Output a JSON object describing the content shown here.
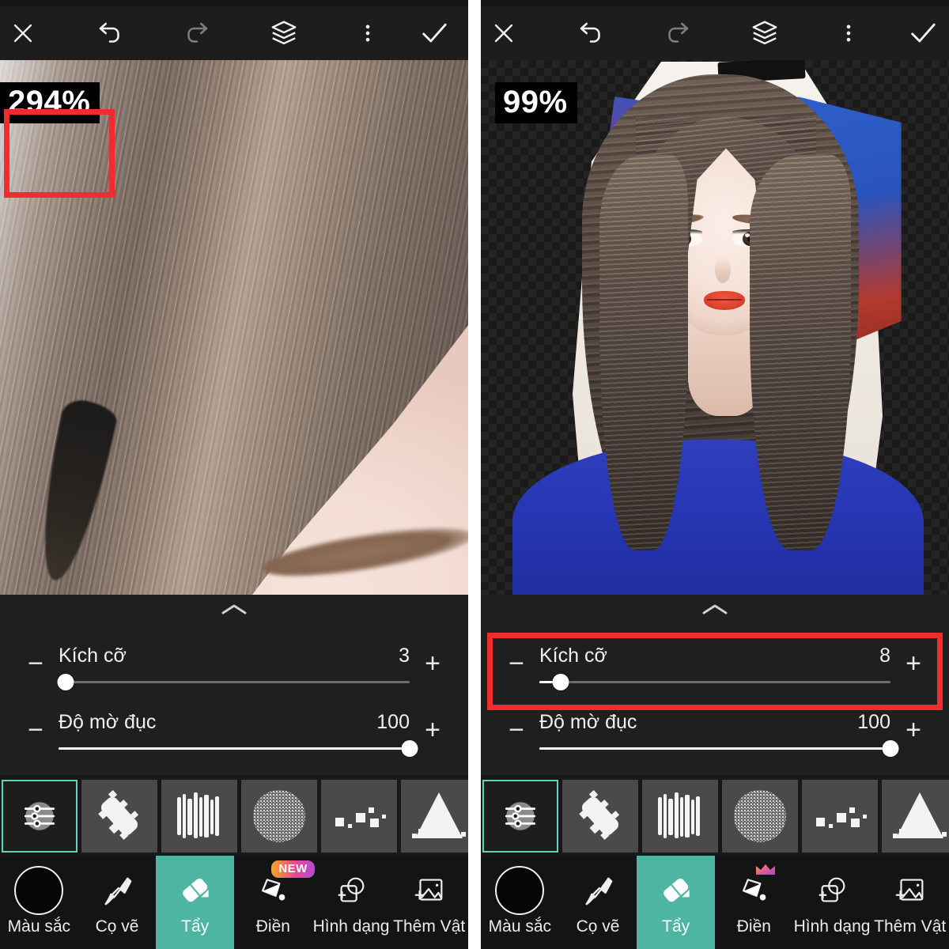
{
  "app": {
    "accent_teal": "#4fb5a3",
    "annotation_red": "#ef2d2d",
    "panel_bg": "#141414",
    "controls_bg": "#1f1f1f"
  },
  "panels": [
    {
      "id": "before",
      "topbar": {
        "close_label": "×",
        "undo_label": "undo",
        "redo_label": "redo",
        "layers_label": "layers",
        "more_label": "more",
        "confirm_label": "✓"
      },
      "canvas": {
        "zoom_level": "294%"
      },
      "sliders": [
        {
          "name": "size",
          "label": "Kích cỡ",
          "value": "3",
          "percent": 2,
          "minus": "−",
          "plus": "+",
          "fill": false
        },
        {
          "name": "opacity",
          "label": "Độ mờ đục",
          "value": "100",
          "percent": 100,
          "minus": "−",
          "plus": "+",
          "fill": true
        }
      ],
      "brushes": [
        {
          "name": "brush-settings",
          "selected": true
        },
        {
          "name": "brush-chalk",
          "selected": false
        },
        {
          "name": "brush-bristle",
          "selected": false
        },
        {
          "name": "brush-noise",
          "selected": false
        },
        {
          "name": "brush-squares",
          "selected": false
        },
        {
          "name": "brush-spray",
          "selected": false
        }
      ],
      "tools": [
        {
          "name": "color",
          "label": "Màu sắc",
          "icon": "color-swatch-icon",
          "active": false,
          "badge": ""
        },
        {
          "name": "brush",
          "label": "Cọ vẽ",
          "icon": "paintbrush-icon",
          "active": false,
          "badge": ""
        },
        {
          "name": "eraser",
          "label": "Tẩy",
          "icon": "eraser-icon",
          "active": true,
          "badge": ""
        },
        {
          "name": "fill",
          "label": "Điền",
          "icon": "paint-bucket-icon",
          "active": false,
          "badge": "NEW"
        },
        {
          "name": "shape",
          "label": "Hình dạng",
          "icon": "shape-icon",
          "active": false,
          "badge": ""
        },
        {
          "name": "addobj",
          "label": "Thêm Vật",
          "icon": "add-image-icon",
          "active": false,
          "badge": ""
        }
      ],
      "annotations": [
        {
          "name": "zoom-level-highlight",
          "target": "zoom-badge"
        }
      ]
    },
    {
      "id": "after",
      "topbar": {
        "close_label": "×",
        "undo_label": "undo",
        "redo_label": "redo",
        "layers_label": "layers",
        "more_label": "more",
        "confirm_label": "✓"
      },
      "canvas": {
        "zoom_level": "99%"
      },
      "sliders": [
        {
          "name": "size",
          "label": "Kích cỡ",
          "value": "8",
          "percent": 6,
          "minus": "−",
          "plus": "+",
          "fill": false
        },
        {
          "name": "opacity",
          "label": "Độ mờ đục",
          "value": "100",
          "percent": 100,
          "minus": "−",
          "plus": "+",
          "fill": true
        }
      ],
      "brushes": [
        {
          "name": "brush-settings",
          "selected": true
        },
        {
          "name": "brush-chalk",
          "selected": false
        },
        {
          "name": "brush-bristle",
          "selected": false
        },
        {
          "name": "brush-noise",
          "selected": false
        },
        {
          "name": "brush-squares",
          "selected": false
        },
        {
          "name": "brush-spray",
          "selected": false
        }
      ],
      "tools": [
        {
          "name": "color",
          "label": "Màu sắc",
          "icon": "color-swatch-icon",
          "active": false,
          "badge": ""
        },
        {
          "name": "brush",
          "label": "Cọ vẽ",
          "icon": "paintbrush-icon",
          "active": false,
          "badge": ""
        },
        {
          "name": "eraser",
          "label": "Tẩy",
          "icon": "eraser-icon",
          "active": true,
          "badge": ""
        },
        {
          "name": "fill",
          "label": "Điền",
          "icon": "paint-bucket-icon",
          "active": false,
          "badge": "crown"
        },
        {
          "name": "shape",
          "label": "Hình dạng",
          "icon": "shape-icon",
          "active": false,
          "badge": ""
        },
        {
          "name": "addobj",
          "label": "Thêm Vật",
          "icon": "add-image-icon",
          "active": false,
          "badge": ""
        }
      ],
      "annotations": [
        {
          "name": "size-slider-highlight",
          "target": "size-slider"
        }
      ]
    }
  ]
}
